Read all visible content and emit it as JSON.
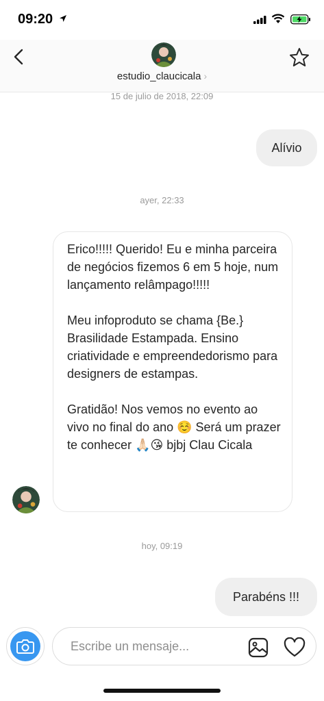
{
  "status_bar": {
    "time": "09:20"
  },
  "header": {
    "username": "estudio_claucicala",
    "chevron": "›"
  },
  "colors": {
    "accent": "#3897f0",
    "bubble_gray": "#efefef",
    "meta_text": "#9a9a9a"
  },
  "messages": [
    {
      "type": "timestamp",
      "text": "15 de julio de 2018, 22:09"
    },
    {
      "type": "outgoing",
      "text": "Alívio"
    },
    {
      "type": "timestamp",
      "text": "ayer, 22:33"
    },
    {
      "type": "incoming",
      "paragraphs": [
        "Erico!!!!! Querido! Eu e minha parceira de negócios fizemos 6 em 5 hoje, num lançamento relâmpago!!!!!",
        "Meu infoproduto se chama {Be.} Brasilidade Estampada. Ensino criatividade e empreendedorismo para designers de estampas.",
        "Gratidão! Nos vemos no evento ao vivo no final do ano ☺️ Será um prazer te conhecer 🙏🏻😘 bjbj Clau Cicala"
      ]
    },
    {
      "type": "timestamp",
      "text": "hoy, 09:19"
    },
    {
      "type": "outgoing",
      "text": "Parabéns !!!"
    }
  ],
  "composer": {
    "placeholder": "Escribe un mensaje..."
  },
  "icons": {
    "back": "back-chevron-icon",
    "star": "star-icon",
    "camera": "camera-icon",
    "gallery": "gallery-icon",
    "heart": "heart-icon"
  }
}
